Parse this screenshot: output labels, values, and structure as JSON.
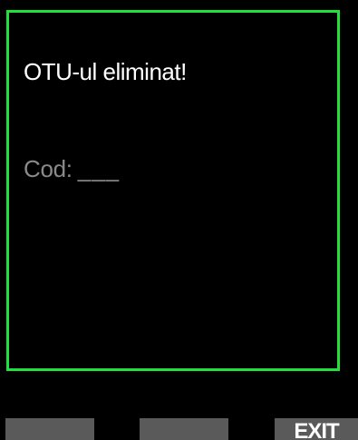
{
  "dialog": {
    "message": "OTU-ul eliminat!",
    "code_label": "Cod:",
    "code_value": "___"
  },
  "softkeys": {
    "left_label": "",
    "middle_label": "",
    "right_label": "EXIT"
  },
  "colors": {
    "background": "#000000",
    "frame_border": "#22e03a",
    "message_text": "#ffffff",
    "code_text": "#8a8a8a",
    "softkey_background": "#5a5a5a",
    "softkey_text": "#ffffff"
  }
}
